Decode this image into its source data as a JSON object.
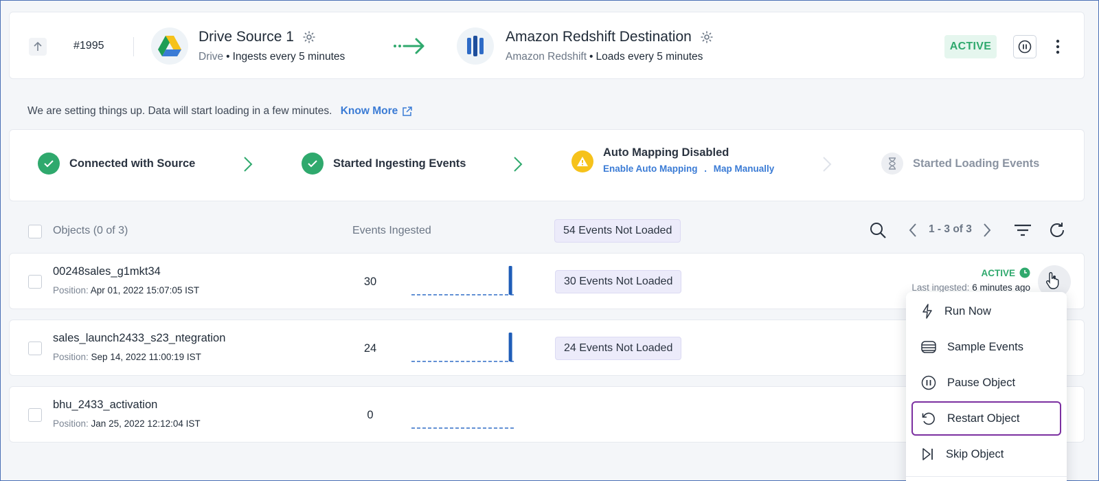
{
  "header": {
    "pipeline_id": "#1995",
    "source": {
      "name": "Drive Source 1",
      "type": "Drive",
      "schedule": "Ingests every 5 minutes"
    },
    "destination": {
      "name": "Amazon Redshift Destination",
      "type": "Amazon Redshift",
      "schedule": "Loads every 5 minutes"
    },
    "status": "ACTIVE",
    "colors": {
      "active_green": "#2fa96d",
      "link_blue": "#3a7bd5",
      "redshift_blue": "#2e6bc6",
      "warning_yellow": "#f6c21b"
    }
  },
  "info": {
    "message": "We are setting things up. Data will start loading in a few minutes.",
    "link": "Know More"
  },
  "steps": [
    {
      "label": "Connected with Source",
      "state": "done"
    },
    {
      "label": "Started Ingesting Events",
      "state": "done"
    },
    {
      "label": "Auto Mapping Disabled",
      "state": "warning",
      "actions": [
        "Enable Auto Mapping",
        "Map Manually"
      ]
    },
    {
      "label": "Started Loading Events",
      "state": "pending"
    }
  ],
  "table": {
    "header": {
      "objects": "Objects (0 of 3)",
      "events_ingested": "Events Ingested",
      "not_loaded": "54 Events Not Loaded",
      "pagination": "1 - 3 of 3"
    },
    "rows": [
      {
        "name": "00248sales_g1mkt34",
        "position_label": "Position:",
        "position": "Apr 01, 2022 15:07:05 IST",
        "events": "30",
        "spark": [
          0,
          0,
          0,
          0,
          0,
          0,
          0,
          0,
          0,
          0,
          0,
          1
        ],
        "not_loaded": "30 Events Not Loaded",
        "status": "ACTIVE",
        "last_ingested_label": "Last ingested:",
        "last_ingested": "6 minutes ago"
      },
      {
        "name": "sales_launch2433_s23_ntegration",
        "position_label": "Position:",
        "position": "Sep 14, 2022 11:00:19 IST",
        "events": "24",
        "spark": [
          0,
          0,
          0,
          0,
          0,
          0,
          0,
          0,
          0,
          0,
          0,
          1
        ],
        "not_loaded": "24 Events Not Loaded"
      },
      {
        "name": "bhu_2433_activation",
        "position_label": "Position:",
        "position": "Jan 25, 2022 12:12:04 IST",
        "events": "0",
        "spark": [
          0,
          0,
          0,
          0,
          0,
          0,
          0,
          0,
          0,
          0,
          0,
          0
        ]
      }
    ]
  },
  "menu": {
    "items": [
      {
        "label": "Run Now",
        "icon": "lightning-icon"
      },
      {
        "label": "Sample Events",
        "icon": "stack-icon"
      },
      {
        "label": "Pause Object",
        "icon": "pause-circle-icon"
      },
      {
        "label": "Restart Object",
        "icon": "restart-icon",
        "selected": true
      },
      {
        "label": "Skip Object",
        "icon": "skip-icon"
      }
    ]
  }
}
